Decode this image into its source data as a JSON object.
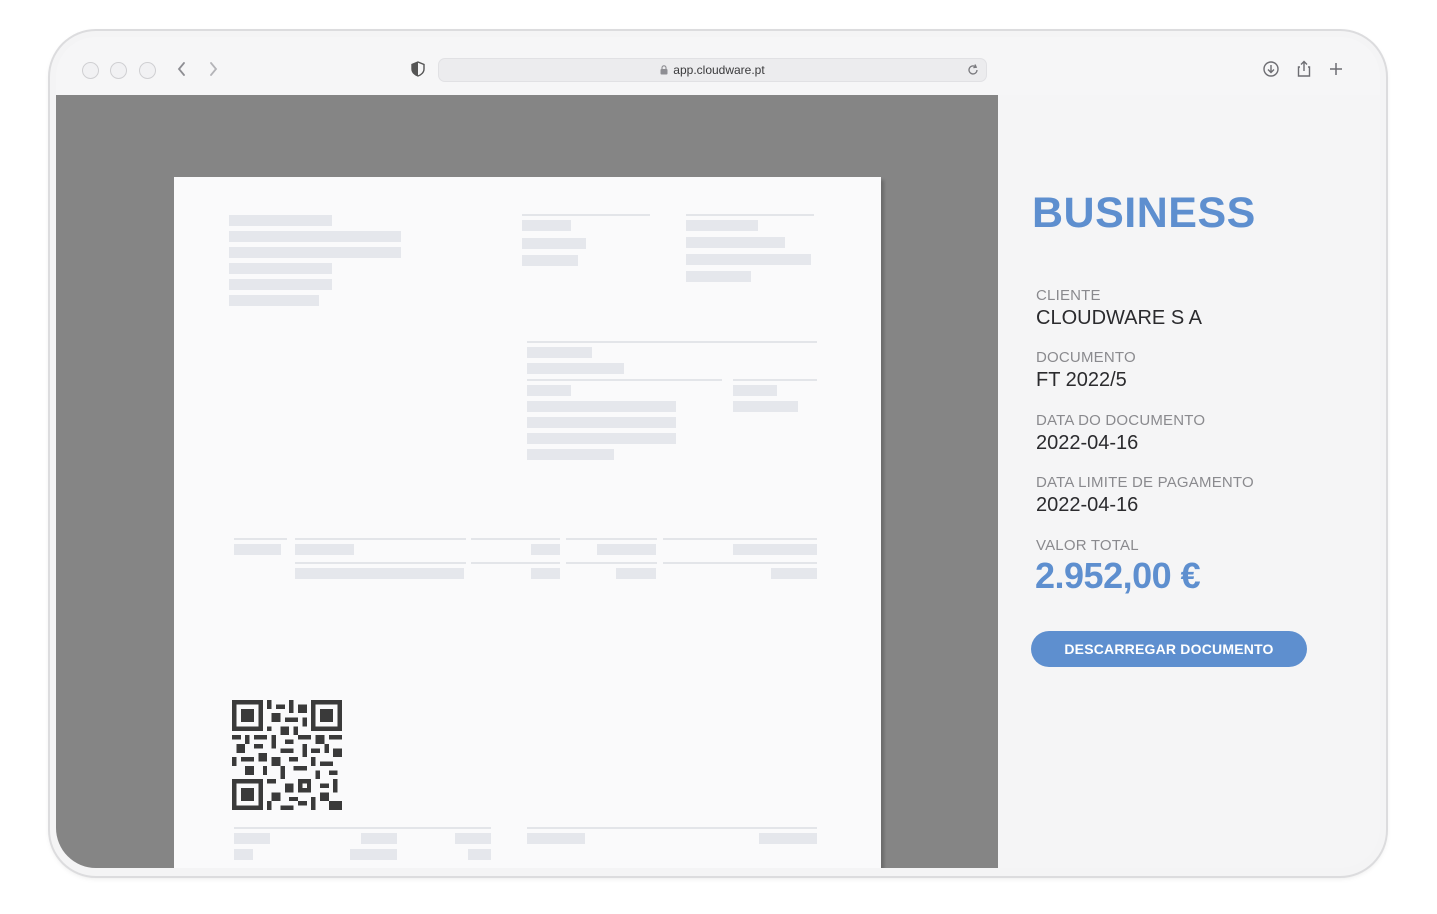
{
  "browser": {
    "url": "app.cloudware.pt"
  },
  "panel": {
    "brand": "BUSINESS",
    "fields": [
      {
        "label": "CLIENTE",
        "value": "CLOUDWARE S A"
      },
      {
        "label": "DOCUMENTO",
        "value": "FT 2022/5"
      },
      {
        "label": "DATA DO DOCUMENTO",
        "value": "2022-04-16"
      },
      {
        "label": "DATA LIMITE DE PAGAMENTO",
        "value": "2022-04-16"
      }
    ],
    "total_label": "VALOR TOTAL",
    "total_value": "2.952,00 €",
    "download_label": "DESCARREGAR DOCUMENTO"
  },
  "colors": {
    "accent": "#5e8fcf",
    "viewer_bg": "#858585"
  },
  "icons": [
    "back-icon",
    "forward-icon",
    "shield-icon",
    "lock-icon",
    "reload-icon",
    "download-icon",
    "share-icon",
    "new-tab-icon",
    "qr-code-icon"
  ]
}
